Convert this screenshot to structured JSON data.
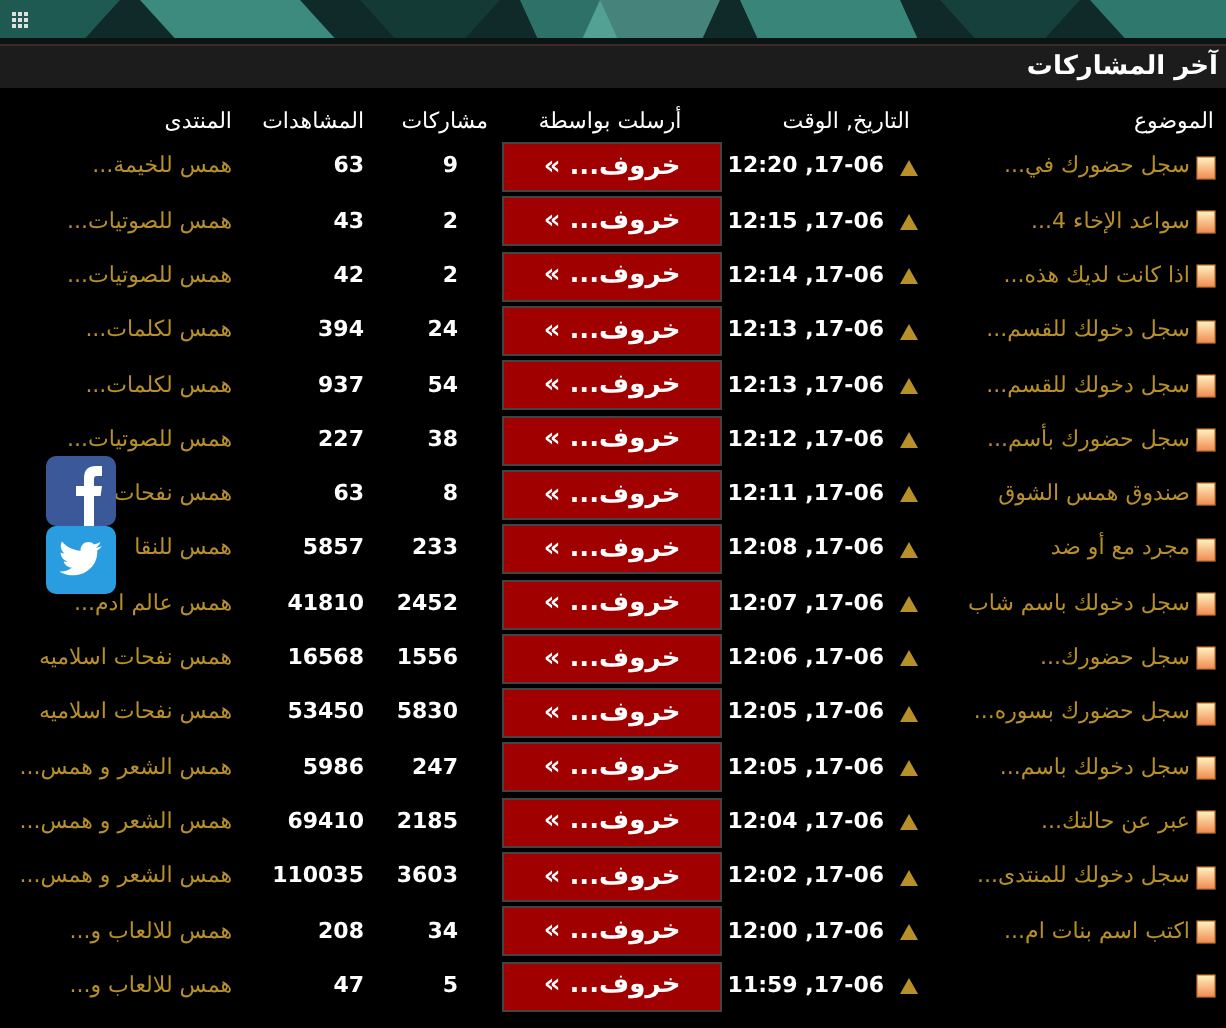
{
  "section": {
    "title": "آخر المشاركات"
  },
  "columns": [
    "الموضوع",
    "التاريخ, الوقت",
    "أرسلت بواسطة",
    "مشاركات",
    "المشاهدات",
    "المنتدى"
  ],
  "rows": [
    {
      "topic": "سجل حضورك في...",
      "date": "12:20 ,17-06",
      "sender": "خروف... »",
      "posts": "9",
      "views": "63",
      "forum": "همس للخيمة..."
    },
    {
      "topic": "سواعد الإخاء 4...",
      "date": "12:15 ,17-06",
      "sender": "خروف... »",
      "posts": "2",
      "views": "43",
      "forum": "همس للصوتيات..."
    },
    {
      "topic": "اذا كانت لديك هذه...",
      "date": "12:14 ,17-06",
      "sender": "خروف... »",
      "posts": "2",
      "views": "42",
      "forum": "همس للصوتيات..."
    },
    {
      "topic": "سجل دخولك للقسم...",
      "date": "12:13 ,17-06",
      "sender": "خروف... »",
      "posts": "24",
      "views": "394",
      "forum": "همس لكلمات..."
    },
    {
      "topic": "سجل دخولك للقسم...",
      "date": "12:13 ,17-06",
      "sender": "خروف... »",
      "posts": "54",
      "views": "937",
      "forum": "همس لكلمات..."
    },
    {
      "topic": "سجل حضورك بأسم...",
      "date": "12:12 ,17-06",
      "sender": "خروف... »",
      "posts": "38",
      "views": "227",
      "forum": "همس للصوتيات..."
    },
    {
      "topic": "صندوق همس الشوق",
      "date": "12:11 ,17-06",
      "sender": "خروف... »",
      "posts": "8",
      "views": "63",
      "forum": "همس نفحات"
    },
    {
      "topic": "مجرد مع أو ضد",
      "date": "12:08 ,17-06",
      "sender": "خروف... »",
      "posts": "233",
      "views": "5857",
      "forum": "همس للنقا"
    },
    {
      "topic": "سجل دخولك باسم شاب",
      "date": "12:07 ,17-06",
      "sender": "خروف... »",
      "posts": "2452",
      "views": "41810",
      "forum": "همس عالم ادم..."
    },
    {
      "topic": "سجل حضورك...",
      "date": "12:06 ,17-06",
      "sender": "خروف... »",
      "posts": "1556",
      "views": "16568",
      "forum": "همس نفحات اسلاميه"
    },
    {
      "topic": "سجل حضورك بسوره...",
      "date": "12:05 ,17-06",
      "sender": "خروف... »",
      "posts": "5830",
      "views": "53450",
      "forum": "همس نفحات اسلاميه"
    },
    {
      "topic": "سجل دخولك باسم...",
      "date": "12:05 ,17-06",
      "sender": "خروف... »",
      "posts": "247",
      "views": "5986",
      "forum": "همس الشعر و همس..."
    },
    {
      "topic": "عبر عن حالتك...",
      "date": "12:04 ,17-06",
      "sender": "خروف... »",
      "posts": "2185",
      "views": "69410",
      "forum": "همس الشعر و همس..."
    },
    {
      "topic": "سجل دخولك للمنتدى...",
      "date": "12:02 ,17-06",
      "sender": "خروف... »",
      "posts": "3603",
      "views": "110035",
      "forum": "همس الشعر و همس..."
    },
    {
      "topic": "اكتب اسم بنات ام...",
      "date": "12:00 ,17-06",
      "sender": "خروف... »",
      "posts": "34",
      "views": "208",
      "forum": "همس للالعاب و..."
    },
    {
      "date": "11:59 ,17-06",
      "sender": "خروف... »",
      "posts": "5",
      "views": "47",
      "forum": "همس للالعاب و..."
    }
  ]
}
